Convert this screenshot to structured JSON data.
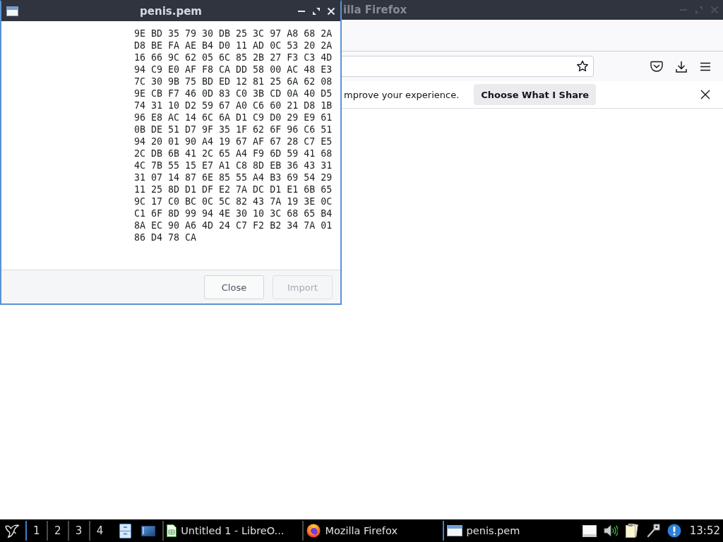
{
  "dialog": {
    "title": "penis.pem",
    "hex_lines": [
      "9E BD 35 79 30 DB 25 3C 97 A8 68 2A",
      "D8 BE FA AE B4 D0 11 AD 0C 53 20 2A",
      "16 66 9C 62 05 6C 85 2B 27 F3 C3 4D",
      "94 C9 E0 AF F8 CA DD 58 00 AC 48 E3",
      "7C 30 9B 75 BD ED 12 81 25 6A 62 08",
      "9E CB F7 46 0D 83 C0 3B CD 0A 40 D5",
      "74 31 10 D2 59 67 A0 C6 60 21 D8 1B",
      "96 E8 AC 14 6C 6A D1 C9 D0 29 E9 61",
      "0B DE 51 D7 9F 35 1F 62 6F 96 C6 51",
      "94 20 01 90 A4 19 67 AF 67 28 C7 E5",
      "2C DB 6B 41 2C 65 A4 F9 6D 59 41 68",
      "4C 7B 55 15 E7 A1 C8 8D EB 36 43 31",
      "31 07 14 87 6E 85 55 A4 B3 69 54 29",
      "11 25 8D D1 DF E2 7A DC D1 E1 6B 65",
      "9C 17 C0 BC 0C 5C 82 43 7A 19 3E 0C",
      "C1 6F 8D 99 94 4E 30 10 3C 68 65 B4",
      "8A EC 90 A6 4D 24 C7 F2 B2 34 7A 01",
      "86 D4 78 CA"
    ],
    "buttons": [
      {
        "label": "Close",
        "disabled": false
      },
      {
        "label": "Import",
        "disabled": true
      }
    ]
  },
  "browser": {
    "title": "illa Firefox",
    "notification": {
      "text": "mprove your experience.",
      "button": "Choose What I Share"
    }
  },
  "taskbar": {
    "workspaces": [
      {
        "label": "1",
        "selected": true
      },
      {
        "label": "2",
        "selected": false
      },
      {
        "label": "3",
        "selected": false
      },
      {
        "label": "4",
        "selected": false
      }
    ],
    "tasks": [
      {
        "label": "Untitled 1 - LibreO...",
        "kind": "spreadsheet",
        "selected": false
      },
      {
        "label": "Mozilla Firefox",
        "kind": "browser",
        "selected": false
      },
      {
        "label": "penis.pem",
        "kind": "window",
        "selected": true
      }
    ],
    "clock": "13:52"
  }
}
